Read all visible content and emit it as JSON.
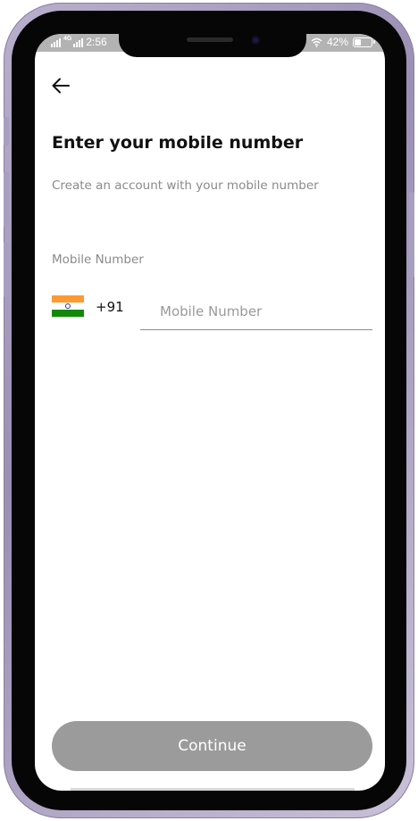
{
  "status_bar": {
    "network_label": "4G",
    "time": "2:56",
    "battery_percent": "42%",
    "battery_level": 0.42,
    "icons": [
      "signal-icon",
      "signal-icon",
      "wifi-icon",
      "battery-icon"
    ]
  },
  "nav": {
    "back_icon": "arrow-left-icon"
  },
  "screen": {
    "title": "Enter your mobile number",
    "subtitle": "Create an account with your mobile number",
    "field_label": "Mobile Number"
  },
  "phone": {
    "country_flag": "india-flag-icon",
    "dial_code": "+91",
    "value": "",
    "placeholder": "Mobile Number"
  },
  "actions": {
    "continue_label": "Continue"
  },
  "colors": {
    "title": "#111111",
    "muted_text": "#8a8a8a",
    "button_disabled": "#9b9b9b",
    "status_bar": "#b3b3b3",
    "flag_saffron": "#ff9933",
    "flag_white": "#ffffff",
    "flag_green": "#138808",
    "flag_chakra": "#2e3a8c"
  }
}
